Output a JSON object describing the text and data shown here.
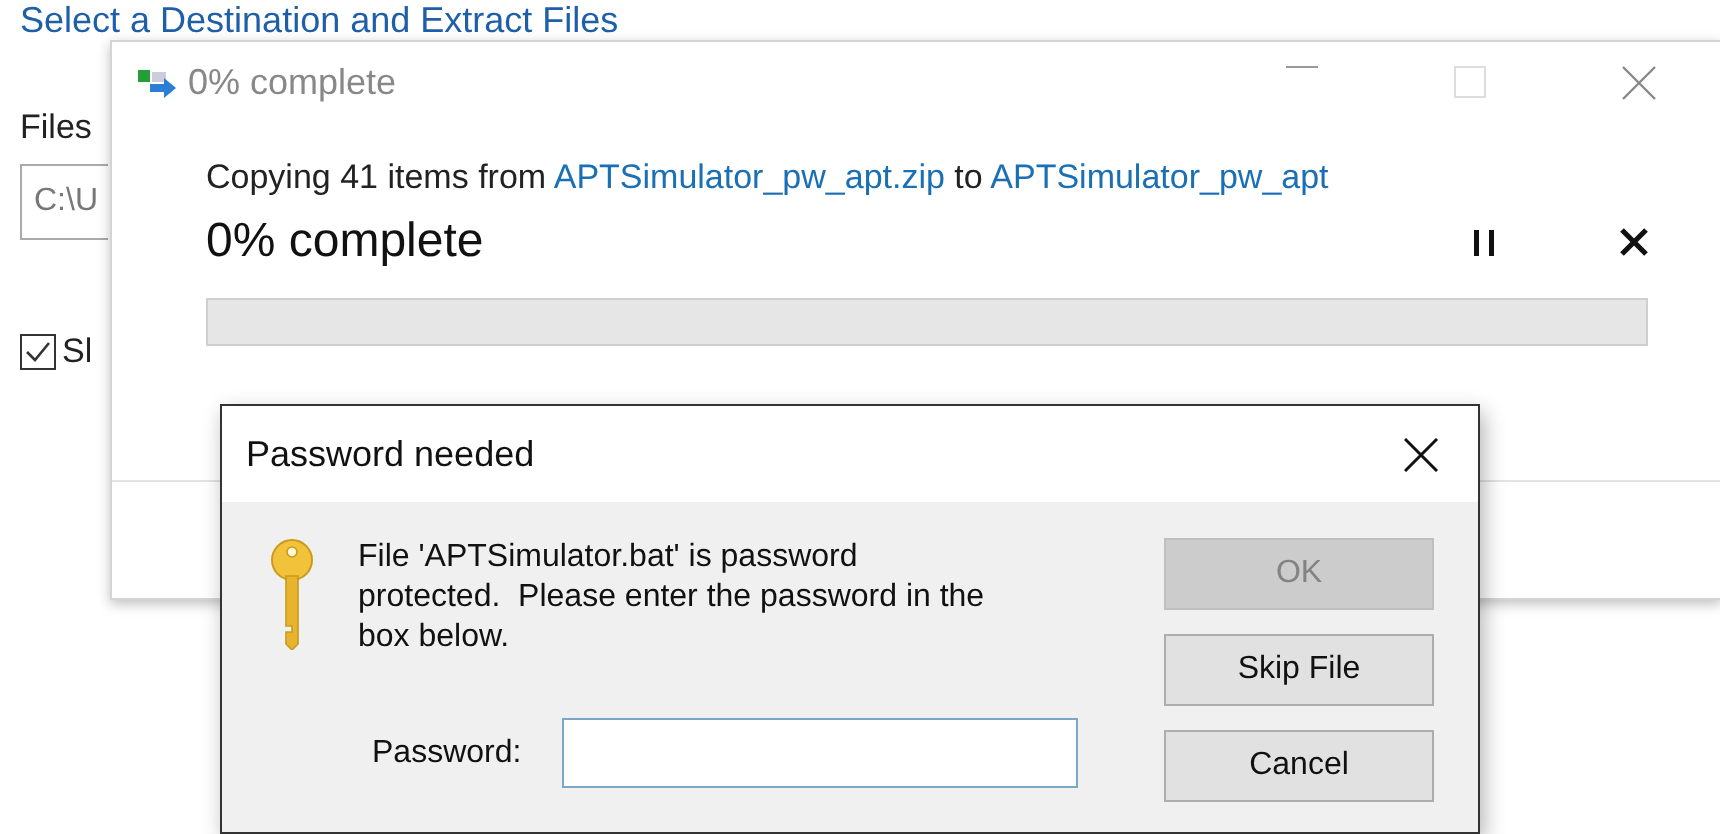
{
  "background": {
    "title": "Select a Destination and Extract Files",
    "files_label": "Files",
    "path_field_value": "C:\\U",
    "checkbox": {
      "label": "Sl",
      "checked": true
    }
  },
  "progress_window": {
    "title": "0% complete",
    "message": [
      {
        "kind": "text",
        "text": "Copying 41 items from "
      },
      {
        "kind": "link",
        "text": "APTSimulator_pw_apt.zip"
      },
      {
        "kind": "text",
        "text": " to "
      },
      {
        "kind": "link",
        "text": "APTSimulator_pw_apt"
      }
    ],
    "status": "0% complete",
    "progress": {
      "level": 0
    }
  },
  "password_dialog": {
    "title": "Password needed",
    "message": "File 'APTSimulator.bat' is password protected.  Please enter the password in the box below.",
    "password_label": "Password:",
    "buttons": [
      {
        "label": "OK",
        "disabled": true
      },
      {
        "label": "Skip File",
        "disabled": false
      },
      {
        "label": "Cancel",
        "disabled": false
      }
    ]
  }
}
